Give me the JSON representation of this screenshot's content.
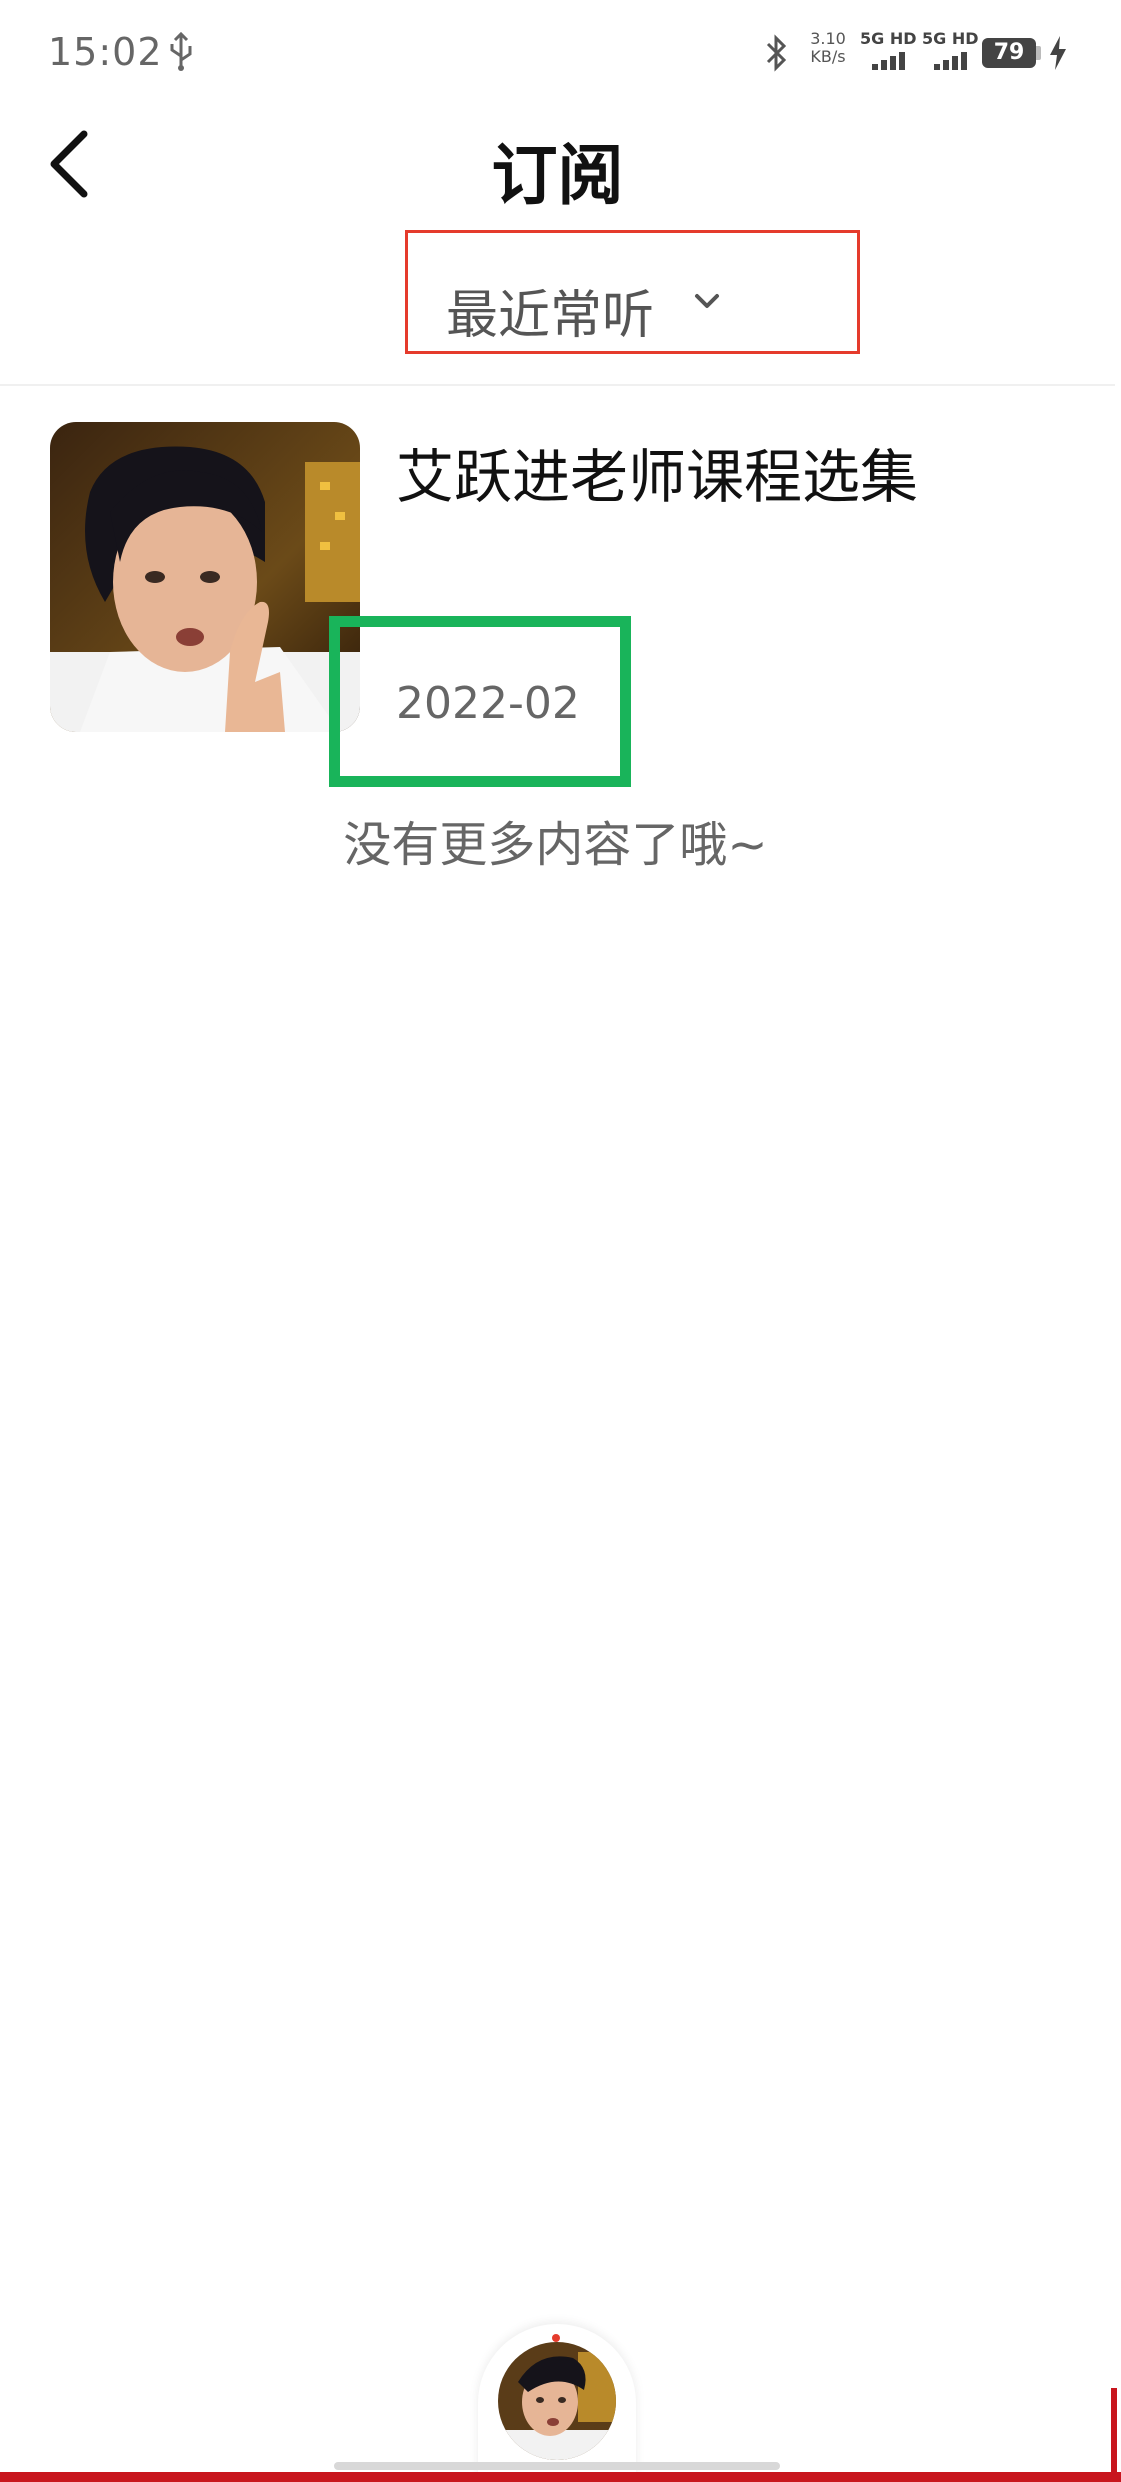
{
  "status_bar": {
    "time": "15:02",
    "network_speed_value": "3.10",
    "network_speed_unit": "KB/s",
    "signal_1_label": "5G HD",
    "signal_2_label": "5G HD",
    "battery_level": "79",
    "icons": [
      "usb-icon",
      "bluetooth-icon",
      "signal-icon",
      "battery-icon",
      "charging-icon"
    ]
  },
  "header": {
    "title": "订阅",
    "back_icon": "chevron-left-icon"
  },
  "filter": {
    "selected_label": "最近常听",
    "icon": "chevron-down-icon"
  },
  "subscriptions": [
    {
      "title": "艾跃进老师课程选集",
      "date": "2022-02"
    }
  ],
  "list_end_text": "没有更多内容了哦~",
  "colors": {
    "filter_highlight": "#e53b2c",
    "date_highlight": "#19b45a",
    "brand_red": "#c8161e"
  }
}
